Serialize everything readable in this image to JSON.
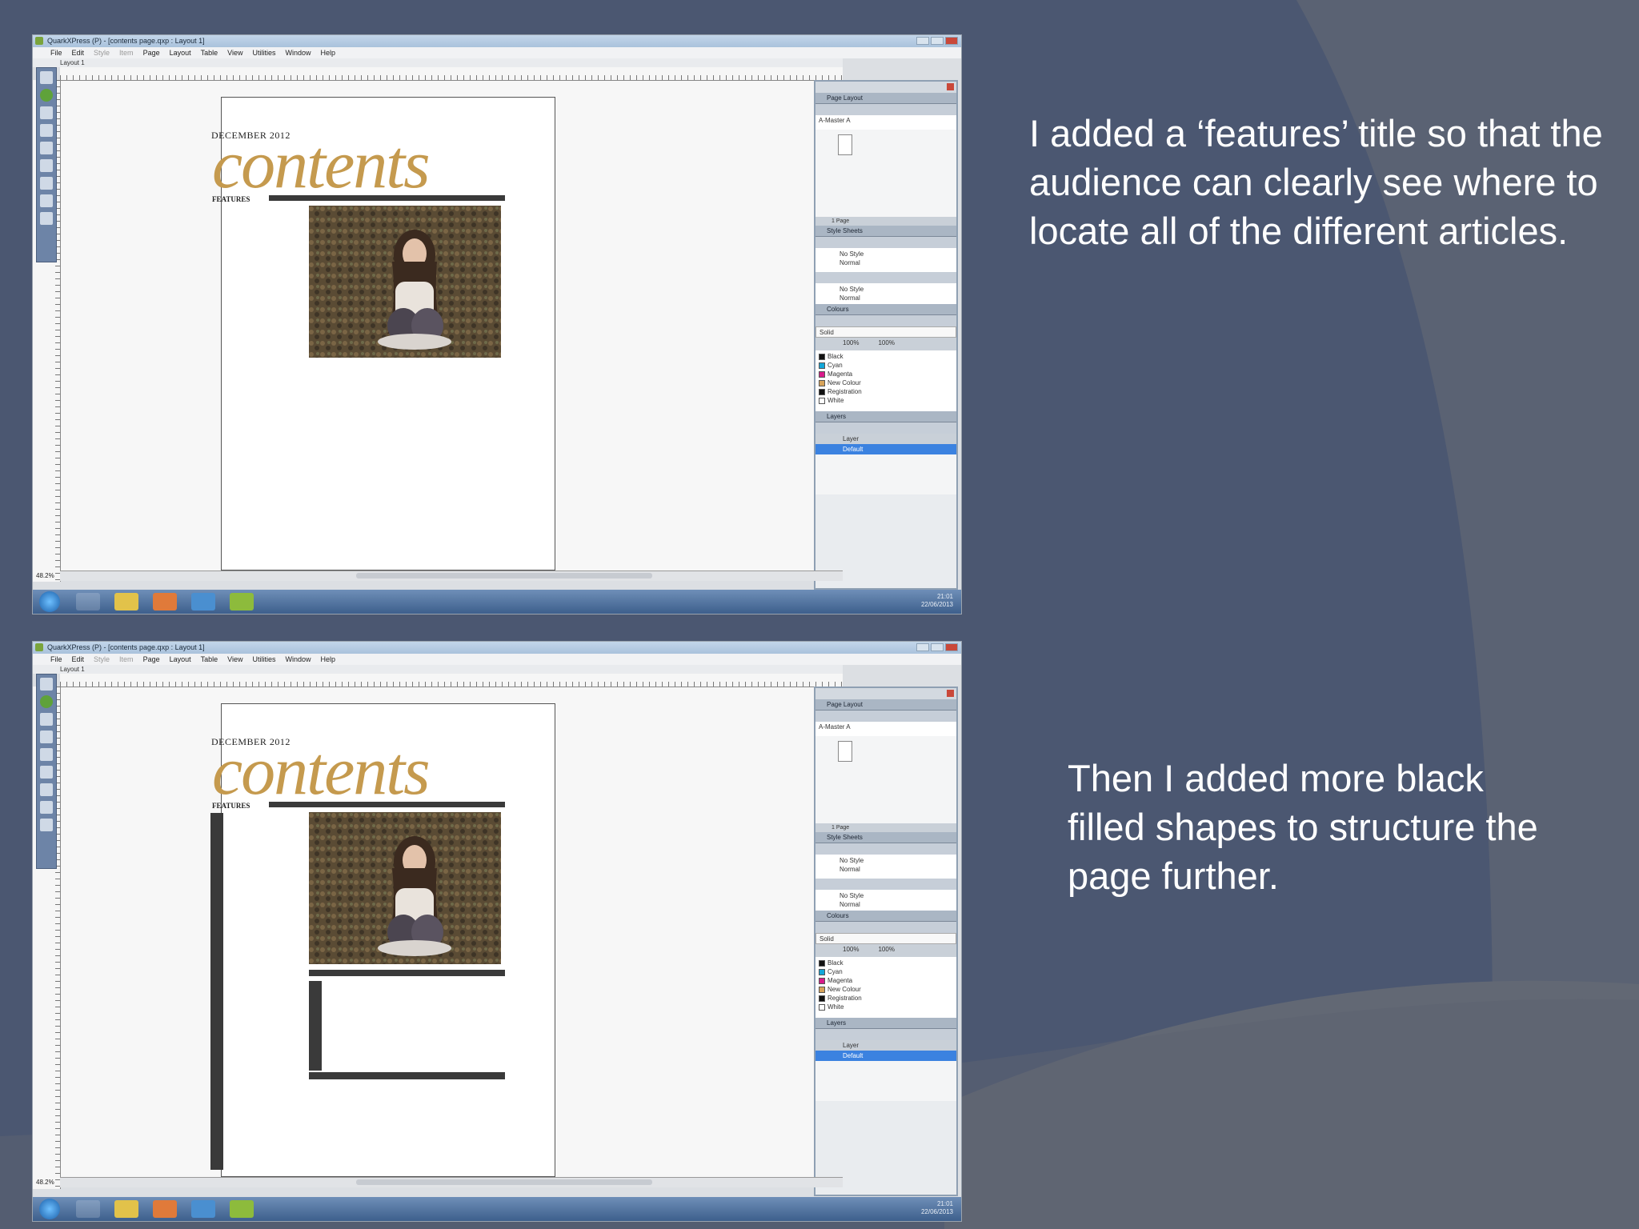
{
  "slide": {
    "caption_top": "I added a ‘features’ title so that the audience can clearly see where to locate all of the different articles.",
    "caption_bottom": "Then I added more black filled shapes to structure the page further."
  },
  "app": {
    "title": "QuarkXPress (P) - [contents page.qxp : Layout 1]",
    "menus": [
      "File",
      "Edit",
      "Style",
      "Item",
      "Page",
      "Layout",
      "Table",
      "View",
      "Utilities",
      "Window",
      "Help"
    ],
    "layout_tab": "Layout 1",
    "zoom": "48.2%"
  },
  "document": {
    "date": "DECEMBER 2012",
    "title": "contents",
    "section": "FEATURES"
  },
  "palettes": {
    "page_layout": {
      "title": "Page Layout",
      "master": "A-Master A",
      "page_label": "1 Page"
    },
    "style_sheets": {
      "title": "Style Sheets",
      "items": [
        "No Style",
        "Normal"
      ],
      "char_items": [
        "No Style",
        "Normal"
      ]
    },
    "colours": {
      "title": "Colours",
      "field": "Solid",
      "shade": "100%",
      "opacity": "100%",
      "items": [
        {
          "name": "Black",
          "color": "#111111"
        },
        {
          "name": "Cyan",
          "color": "#12a6d8"
        },
        {
          "name": "Magenta",
          "color": "#d81b8a"
        },
        {
          "name": "New Colour",
          "color": "#d7a35a"
        },
        {
          "name": "Registration",
          "color": "#111111"
        },
        {
          "name": "White",
          "color": "#ffffff"
        }
      ]
    },
    "layers": {
      "title": "Layers",
      "header": "Layer",
      "selected": "Default"
    }
  },
  "taskbar": {
    "time_top": "21:01",
    "date_top": "22/06/2013",
    "time_bottom": "21:01",
    "date_bottom": "22/06/2013"
  }
}
